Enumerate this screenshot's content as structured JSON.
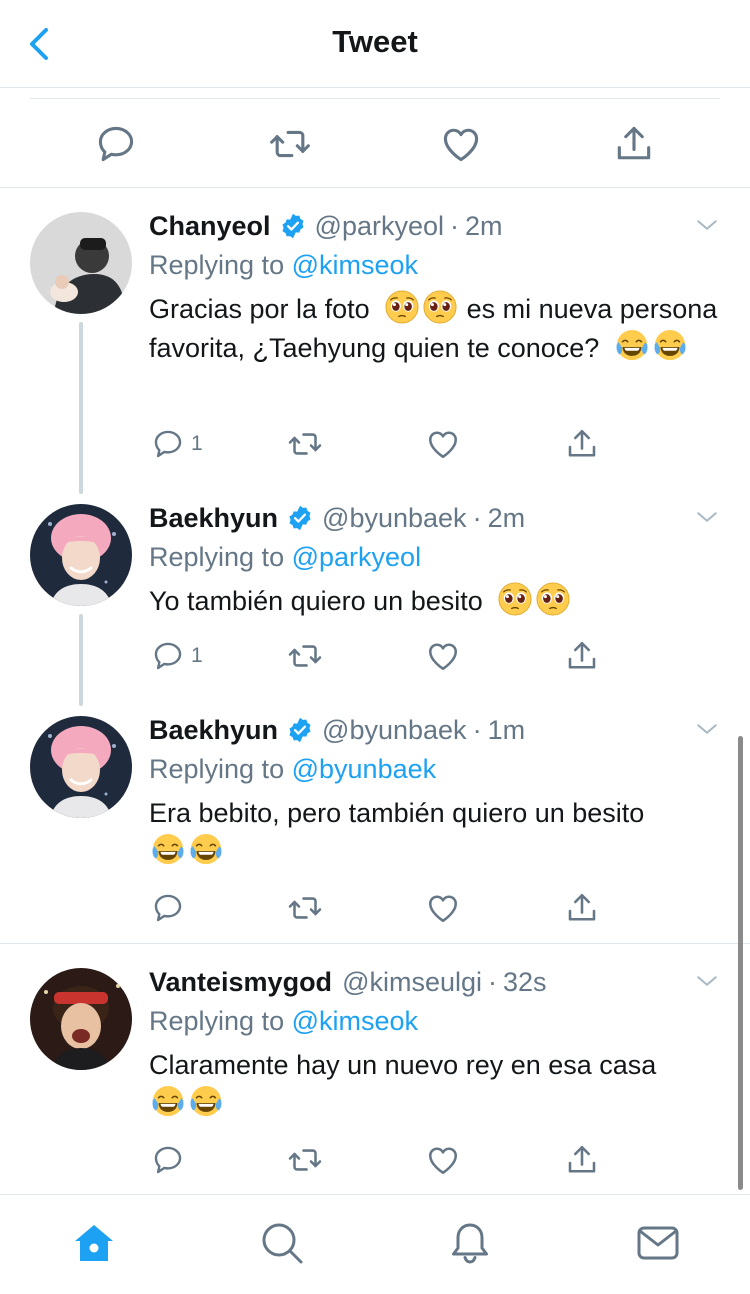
{
  "header": {
    "title": "Tweet"
  },
  "replies": [
    {
      "name": "Chanyeol",
      "verified": true,
      "handle": "@parkyeol",
      "time": "2m",
      "replying_prefix": "Replying to",
      "replying_to": "@kimseok",
      "text_parts": [
        "Gracias por la foto",
        "es mi nueva persona favorita, ¿Taehyung quien te conoce?"
      ],
      "reply_count": "1"
    },
    {
      "name": "Baekhyun",
      "verified": true,
      "handle": "@byunbaek",
      "time": "2m",
      "replying_prefix": "Replying to",
      "replying_to": "@parkyeol",
      "text_parts": [
        "Yo también quiero un besito"
      ],
      "reply_count": "1"
    },
    {
      "name": "Baekhyun",
      "verified": true,
      "handle": "@byunbaek",
      "time": "1m",
      "replying_prefix": "Replying to",
      "replying_to": "@byunbaek",
      "text_parts": [
        "Era bebito, pero también quiero un besito"
      ],
      "reply_count": ""
    },
    {
      "name": "Vanteismygod",
      "verified": false,
      "handle": "@kimseulgi",
      "time": "32s",
      "replying_prefix": "Replying to",
      "replying_to": "@kimseok",
      "text_parts": [
        "Claramente hay un nuevo rey en esa casa"
      ],
      "reply_count": ""
    }
  ],
  "colors": {
    "accent": "#1da1f2",
    "secondary": "#657786",
    "text": "#14171a",
    "border": "#e1e8ed"
  },
  "icons": {
    "header": [
      "back-chevron-icon"
    ],
    "actions": [
      "reply-icon",
      "retweet-icon",
      "like-icon",
      "share-icon"
    ],
    "tabs": [
      "home-icon",
      "search-icon",
      "notifications-icon",
      "messages-icon"
    ],
    "emoji": [
      "pleading-face-emoji",
      "tears-of-joy-emoji"
    ]
  }
}
